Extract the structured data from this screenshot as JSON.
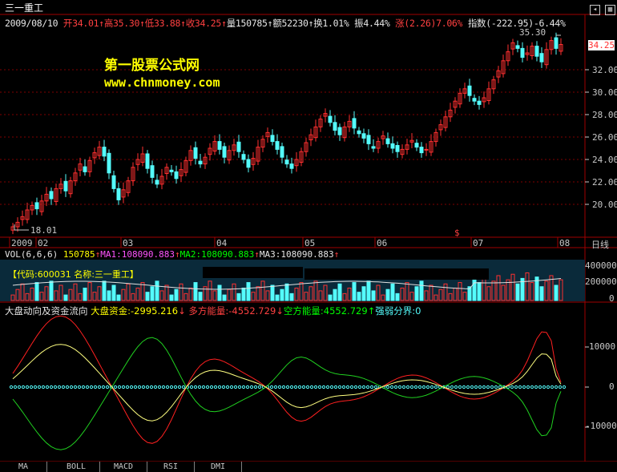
{
  "header": {
    "stock_name": "三一重工",
    "quote": {
      "date": "2009/08/10",
      "open": "开34.01",
      "high": "高35.30",
      "low": "低33.88",
      "close": "收34.25",
      "volume": "量150785",
      "amount": "额52230",
      "turnover": "换1.01%",
      "amplitude": "振4.44%",
      "change": "涨(2.26)7.06%",
      "index": "指数(-222.95)-6.44%"
    }
  },
  "watermark": {
    "line1": "第一股票公式网",
    "line2": "www.chnmoney.com"
  },
  "price_panel": {
    "y_ticks": [
      "32.00",
      "30.00",
      "28.00",
      "26.00",
      "24.00",
      "22.00",
      "20.00"
    ],
    "high_label": "35.30",
    "low_label": "18.01",
    "current_price": "34.25",
    "x_ticks": [
      "2009",
      "02",
      "03",
      "04",
      "05",
      "06",
      "07",
      "08"
    ],
    "period_label": "日线",
    "dividend_marker": "$"
  },
  "volume_panel": {
    "params": "VOL(6,6,6)",
    "vol": "150785",
    "ma1": "MA1:108090.883",
    "ma2": "MA2:108090.883",
    "ma3": "MA3:108090.883",
    "code_label": "【代码:600031 名称:三一重工】",
    "y_ticks": [
      "400000",
      "200000",
      "0"
    ]
  },
  "flow_panel": {
    "title": "大盘动向及资金流向",
    "market_fund": "大盘资金:-2995.216",
    "long_energy": "多方能量:-4552.729",
    "short_energy": "空方能量:4552.729",
    "divide": "强弱分界:0",
    "y_ticks": [
      "10000",
      "0",
      "-10000"
    ]
  },
  "tabs": [
    "MA",
    "BOLL",
    "MACD",
    "RSI",
    "DMI"
  ],
  "colors": {
    "up": "#ff3030",
    "down": "#54fcfc",
    "grid": "#800000",
    "axis": "#a00000",
    "fund_line": "#ffff80",
    "long_line": "#ff2020",
    "short_line": "#20d020",
    "divide_line": "#54fcfc"
  },
  "chart_data": {
    "type": "candlestick",
    "closes": [
      18.0,
      18.4,
      18.9,
      19.5,
      19.9,
      19.6,
      20.3,
      20.9,
      20.5,
      21.4,
      21.8,
      21.2,
      22.1,
      22.8,
      23.6,
      22.9,
      23.9,
      24.6,
      25.1,
      24.3,
      22.8,
      21.4,
      20.4,
      21.3,
      22.1,
      23.3,
      24.0,
      24.5,
      23.2,
      22.4,
      21.8,
      22.5,
      23.3,
      22.9,
      22.3,
      23.1,
      23.9,
      24.8,
      24.1,
      23.6,
      24.2,
      25.0,
      25.6,
      24.9,
      24.2,
      24.8,
      25.3,
      24.7,
      24.0,
      23.3,
      24.1,
      25.1,
      25.8,
      26.4,
      25.6,
      24.9,
      24.2,
      23.6,
      23.2,
      24.0,
      24.7,
      25.5,
      26.2,
      26.9,
      27.6,
      28.1,
      27.3,
      26.6,
      26.2,
      26.9,
      27.4,
      26.8,
      26.3,
      25.9,
      25.4,
      25.0,
      25.6,
      26.1,
      25.4,
      25.0,
      24.7,
      24.9,
      25.3,
      25.7,
      25.1,
      24.6,
      24.9,
      25.6,
      26.4,
      27.1,
      27.8,
      28.4,
      29.2,
      29.9,
      30.3,
      29.7,
      29.2,
      28.9,
      29.5,
      30.3,
      31.1,
      31.9,
      32.8,
      33.6,
      34.4,
      33.9,
      33.1,
      33.5,
      34.1,
      33.2,
      32.7,
      33.8,
      34.6,
      33.9,
      34.25
    ]
  }
}
